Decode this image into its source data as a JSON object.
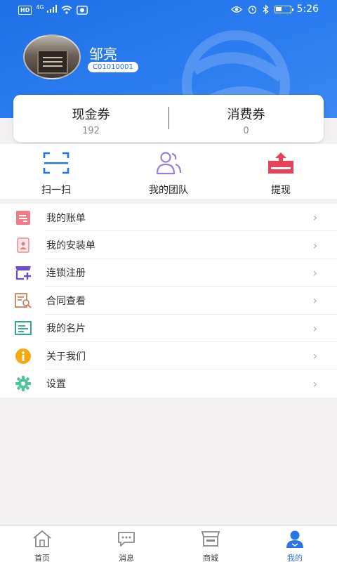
{
  "status_bar": {
    "left_badges": [
      "HD",
      "4G"
    ],
    "time": "5:26"
  },
  "profile": {
    "name": "邹亮",
    "code": "C01010001"
  },
  "vouchers": [
    {
      "title": "现金券",
      "value": "192"
    },
    {
      "title": "消费券",
      "value": "0"
    }
  ],
  "quick_actions": [
    {
      "label": "扫一扫",
      "icon": "scan-icon"
    },
    {
      "label": "我的团队",
      "icon": "team-icon"
    },
    {
      "label": "提现",
      "icon": "withdraw-icon"
    }
  ],
  "menu": [
    {
      "label": "我的账单",
      "icon": "bill-icon"
    },
    {
      "label": "我的安装单",
      "icon": "install-order-icon"
    },
    {
      "label": "连锁注册",
      "icon": "store-register-icon"
    },
    {
      "label": "合同查看",
      "icon": "contract-search-icon"
    },
    {
      "label": "我的名片",
      "icon": "business-card-icon"
    },
    {
      "label": "关于我们",
      "icon": "info-icon"
    },
    {
      "label": "设置",
      "icon": "settings-gear-icon"
    }
  ],
  "tabs": [
    {
      "label": "首页",
      "icon": "home-icon",
      "active": false
    },
    {
      "label": "消息",
      "icon": "message-icon",
      "active": false
    },
    {
      "label": "商城",
      "icon": "shop-icon",
      "active": false
    },
    {
      "label": "我的",
      "icon": "profile-icon",
      "active": true
    }
  ],
  "colors": {
    "header_blue": "#2a73e8",
    "accent_blue": "#2a73e8",
    "page_bg": "#f2f0f0"
  }
}
